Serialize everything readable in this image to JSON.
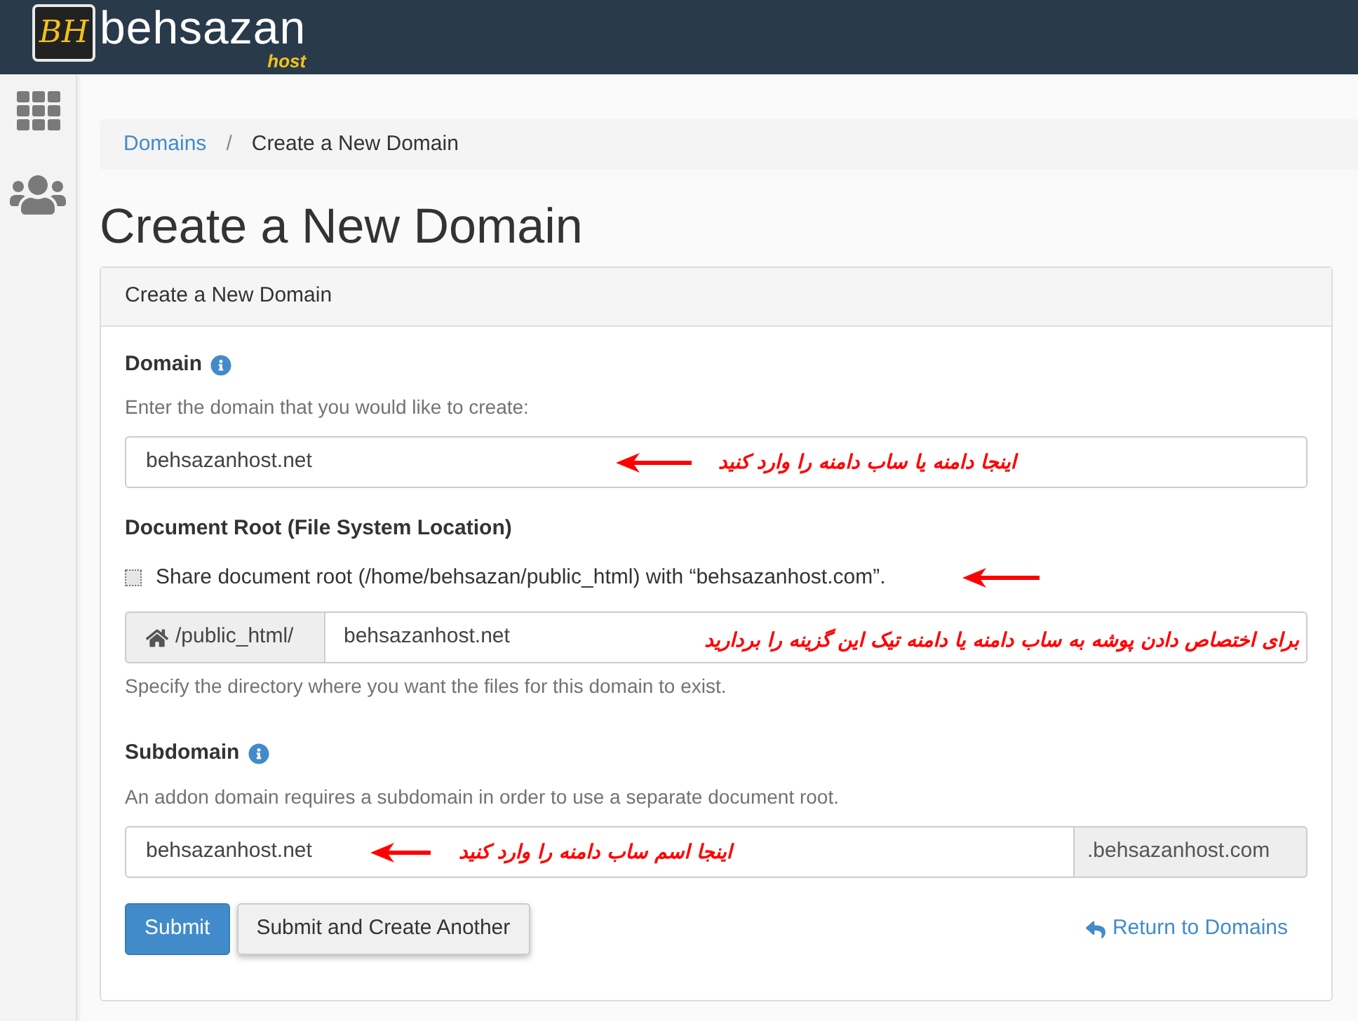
{
  "header": {
    "logo": {
      "mark": "BH",
      "name": "behsazan",
      "tagline": "host"
    }
  },
  "breadcrumb": {
    "separator": "/",
    "items": [
      {
        "label": "Domains",
        "kind": "link"
      },
      {
        "label": "Create a New Domain",
        "kind": "current"
      }
    ]
  },
  "page_title": "Create a New Domain",
  "panel": {
    "title": "Create a New Domain",
    "domain": {
      "label": "Domain",
      "help": "Enter the domain that you would like to create:",
      "value": "behsazanhost.net",
      "annotation": "اینجا دامنه یا ساب دامنه را وارد کنید"
    },
    "document_root": {
      "label": "Document Root (File System Location)",
      "share": {
        "label": "Share document root (/home/behsazan/public_html) with “behsazanhost.com”.",
        "checked": false
      },
      "prefix": "/public_html/",
      "value": "behsazanhost.net",
      "annotation": "برای اختصاص دادن پوشه به ساب دامنه یا دامنه تیک این گزینه را بردارید",
      "help": "Specify the directory where you want the files for this domain to exist."
    },
    "subdomain": {
      "label": "Subdomain",
      "help": "An addon domain requires a subdomain in order to use a separate document root.",
      "value": "behsazanhost.net",
      "annotation": "اینجا اسم ساب دامنه را وارد کنید",
      "suffix": ".behsazanhost.com"
    },
    "actions": {
      "buttons": [
        {
          "label": "Submit",
          "kind": "primary"
        },
        {
          "label": "Submit and Create Another",
          "kind": "default"
        }
      ],
      "link": "Return to Domains"
    }
  }
}
